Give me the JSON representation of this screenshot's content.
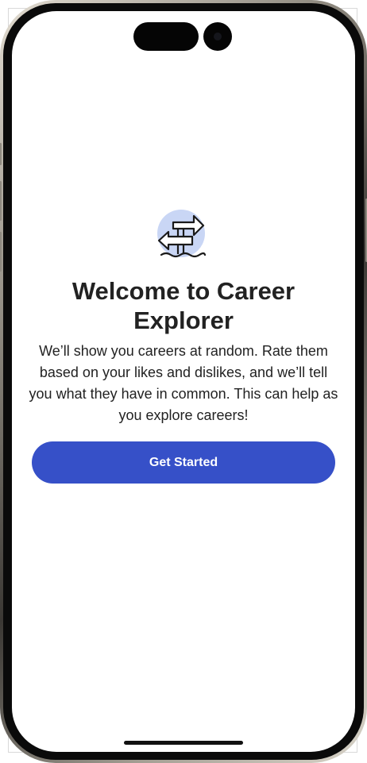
{
  "onboarding": {
    "title": "Welcome to Career Explorer",
    "description": "We’ll show you careers at random. Rate them based on your likes and dislikes, and we’ll tell you what they have in common. This can help as you explore careers!",
    "cta_label": "Get Started",
    "icon": "signpost-icon"
  },
  "colors": {
    "primary": "#3650c8",
    "icon_circle": "#c9d6f5",
    "text": "#222222",
    "background": "#ffffff"
  }
}
